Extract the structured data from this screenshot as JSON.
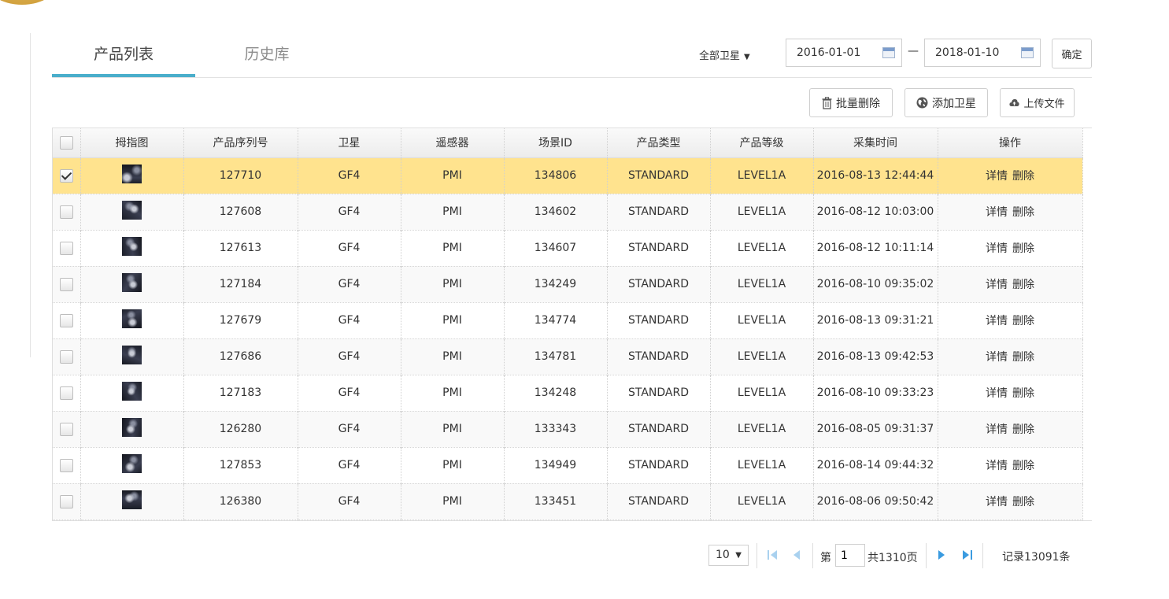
{
  "tabs": [
    {
      "label": "产品列表",
      "active": true
    },
    {
      "label": "历史库",
      "active": false
    }
  ],
  "filters": {
    "satellite_select": "全部卫星",
    "date_from": "2016-01-01",
    "date_to": "2018-01-10",
    "date_separator": "—",
    "confirm_label": "确定"
  },
  "toolbar": {
    "batch_delete_label": "批量删除",
    "add_satellite_label": "添加卫星",
    "upload_label": "上传文件"
  },
  "table": {
    "columns": [
      "拇指图",
      "产品序列号",
      "卫星",
      "遥感器",
      "场景ID",
      "产品类型",
      "产品等级",
      "采集时间",
      "操作"
    ],
    "action_detail": "详情",
    "action_delete": "删除",
    "rows": [
      {
        "serial": "127710",
        "satellite": "GF4",
        "sensor": "PMI",
        "scene_id": "134806",
        "type": "STANDARD",
        "level": "LEVEL1A",
        "time": "2016-08-13 12:44:44",
        "checked": true
      },
      {
        "serial": "127608",
        "satellite": "GF4",
        "sensor": "PMI",
        "scene_id": "134602",
        "type": "STANDARD",
        "level": "LEVEL1A",
        "time": "2016-08-12 10:03:00",
        "checked": false
      },
      {
        "serial": "127613",
        "satellite": "GF4",
        "sensor": "PMI",
        "scene_id": "134607",
        "type": "STANDARD",
        "level": "LEVEL1A",
        "time": "2016-08-12 10:11:14",
        "checked": false
      },
      {
        "serial": "127184",
        "satellite": "GF4",
        "sensor": "PMI",
        "scene_id": "134249",
        "type": "STANDARD",
        "level": "LEVEL1A",
        "time": "2016-08-10 09:35:02",
        "checked": false
      },
      {
        "serial": "127679",
        "satellite": "GF4",
        "sensor": "PMI",
        "scene_id": "134774",
        "type": "STANDARD",
        "level": "LEVEL1A",
        "time": "2016-08-13 09:31:21",
        "checked": false
      },
      {
        "serial": "127686",
        "satellite": "GF4",
        "sensor": "PMI",
        "scene_id": "134781",
        "type": "STANDARD",
        "level": "LEVEL1A",
        "time": "2016-08-13 09:42:53",
        "checked": false
      },
      {
        "serial": "127183",
        "satellite": "GF4",
        "sensor": "PMI",
        "scene_id": "134248",
        "type": "STANDARD",
        "level": "LEVEL1A",
        "time": "2016-08-10 09:33:23",
        "checked": false
      },
      {
        "serial": "126280",
        "satellite": "GF4",
        "sensor": "PMI",
        "scene_id": "133343",
        "type": "STANDARD",
        "level": "LEVEL1A",
        "time": "2016-08-05 09:31:37",
        "checked": false
      },
      {
        "serial": "127853",
        "satellite": "GF4",
        "sensor": "PMI",
        "scene_id": "134949",
        "type": "STANDARD",
        "level": "LEVEL1A",
        "time": "2016-08-14 09:44:32",
        "checked": false
      },
      {
        "serial": "126380",
        "satellite": "GF4",
        "sensor": "PMI",
        "scene_id": "133451",
        "type": "STANDARD",
        "level": "LEVEL1A",
        "time": "2016-08-06 09:50:42",
        "checked": false
      }
    ]
  },
  "pagination": {
    "page_size": "10",
    "page_prefix": "第",
    "current_page": "1",
    "total_pages_text": "共1310页",
    "record_count_text": "记录13091条"
  },
  "colors": {
    "accent": "#4aaecb",
    "selected_row": "#ffe38e",
    "pager_blue": "#3a9be0"
  },
  "icons": {
    "batch_delete": "trash-icon",
    "add_satellite": "globe-icon",
    "upload": "cloud-upload-icon",
    "date": "calendar-icon",
    "first_page": "first-page-icon",
    "prev_page": "prev-page-icon",
    "next_page": "next-page-icon",
    "last_page": "last-page-icon"
  }
}
